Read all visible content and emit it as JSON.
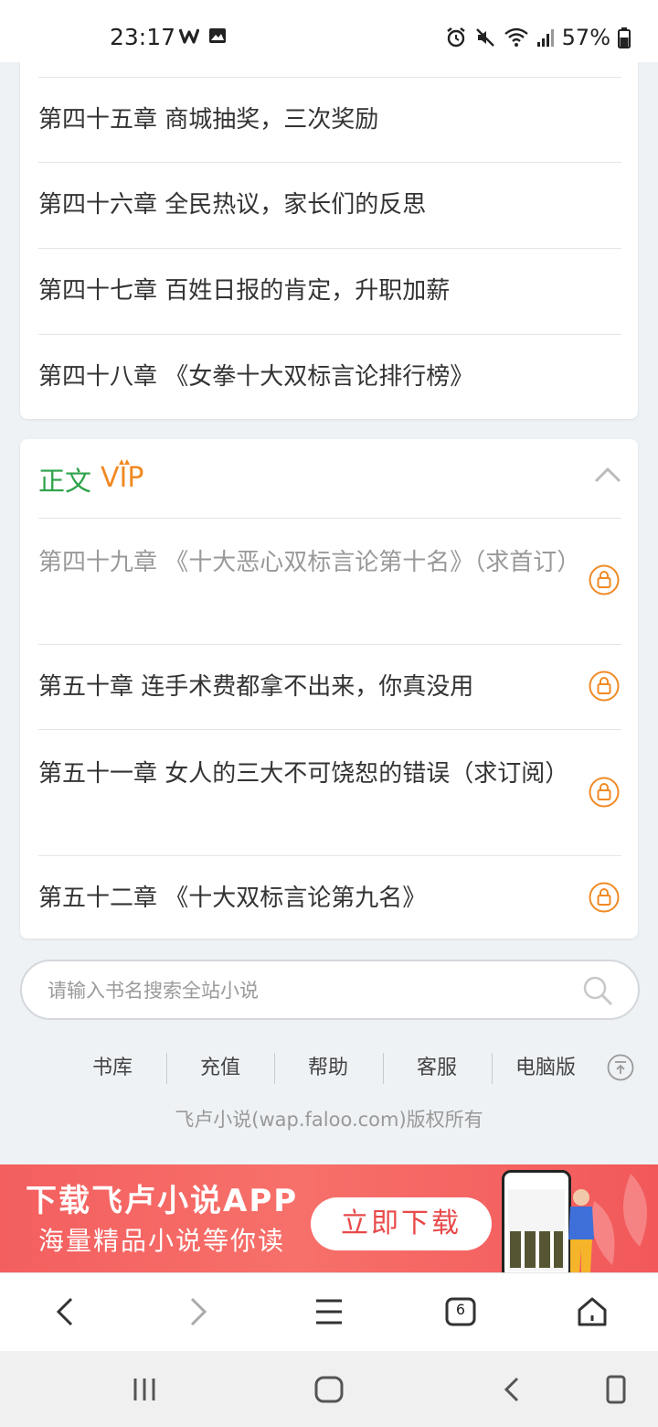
{
  "status_bar": {
    "time": "23:17",
    "battery": "57%",
    "left_icons": [
      "w-app-icon",
      "image-icon"
    ],
    "right_icons": [
      "alarm-icon",
      "mute-icon",
      "wifi-icon",
      "signal-icon",
      "battery-icon"
    ]
  },
  "chapters_free": [
    {
      "title": "第四十五章 商城抽奖，三次奖励"
    },
    {
      "title": "第四十六章 全民热议，家长们的反思"
    },
    {
      "title": "第四十七章 百姓日报的肯定，升职加薪"
    },
    {
      "title": "第四十八章 《女拳十大双标言论排行榜》"
    }
  ],
  "vip_section": {
    "title": "正文",
    "badge": "VIP",
    "chapters": [
      {
        "title": "第四十九章 《十大恶心双标言论第十名》（求首订）",
        "locked": true
      },
      {
        "title": "第五十章 连手术费都拿不出来，你真没用",
        "locked": true
      },
      {
        "title": "第五十一章 女人的三大不可饶恕的错误（求订阅）",
        "locked": true
      },
      {
        "title": "第五十二章 《十大双标言论第九名》",
        "locked": true
      }
    ]
  },
  "search": {
    "placeholder": "请输入书名搜索全站小说"
  },
  "footer": {
    "links": [
      "书库",
      "充值",
      "帮助",
      "客服",
      "电脑版"
    ],
    "copyright": "飞卢小说(wap.faloo.com)版权所有"
  },
  "banner": {
    "title": "下载飞卢小说APP",
    "subtitle": "海量精品小说等你读",
    "button": "立即下载"
  },
  "browser_bar": {
    "tab_count": "6"
  },
  "colors": {
    "accent_green": "#2ea34a",
    "lock_orange": "#f08a24",
    "banner_red": "#f35f5f"
  }
}
